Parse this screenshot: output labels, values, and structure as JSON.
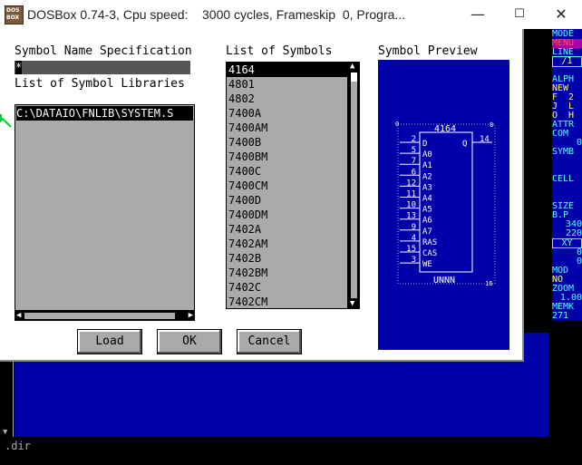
{
  "window": {
    "icon_text": [
      "DOS",
      "BOX"
    ],
    "title": "DOSBox 0.74-3, Cpu speed:    3000 cycles, Frameskip  0, Progra...",
    "minimize": "—",
    "maximize": "☐",
    "close": "✕"
  },
  "dialog": {
    "symbol_name_label": "Symbol Name Specification",
    "symbol_name_value": "*",
    "libraries_label": "List of Symbol Libraries",
    "libraries": [
      "C:\\DATAIO\\FNLIB\\SYSTEM.S"
    ],
    "symbols_label": "List of Symbols",
    "symbols": [
      "4164",
      "4801",
      "4802",
      "7400A",
      "7400AM",
      "7400B",
      "7400BM",
      "7400C",
      "7400CM",
      "7400D",
      "7400DM",
      "7402A",
      "7402AM",
      "7402B",
      "7402BM",
      "7402C",
      "7402CM"
    ],
    "selected_symbol": "4164",
    "preview_label": "Symbol Preview",
    "buttons": {
      "load": "Load",
      "ok": "OK",
      "cancel": "Cancel"
    }
  },
  "preview": {
    "part_name": "4164",
    "ref": "UNNN",
    "corner_left": "0",
    "corner_right": "8",
    "bottom_right": "16",
    "left_pins": [
      {
        "num": "2",
        "name": "D"
      },
      {
        "num": "5",
        "name": "A0"
      },
      {
        "num": "7",
        "name": "A1"
      },
      {
        "num": "6",
        "name": "A2"
      },
      {
        "num": "12",
        "name": "A3"
      },
      {
        "num": "11",
        "name": "A4"
      },
      {
        "num": "10",
        "name": "A5"
      },
      {
        "num": "13",
        "name": "A6"
      },
      {
        "num": "9",
        "name": "A7"
      },
      {
        "num": "4",
        "name": "RAS"
      },
      {
        "num": "15",
        "name": "CAS"
      },
      {
        "num": "3",
        "name": "WE"
      }
    ],
    "right_pins": [
      {
        "num": "14",
        "name": "Q"
      }
    ]
  },
  "sidepanel": {
    "items": [
      "MODE",
      "MENU",
      "LINE",
      "/1",
      "ALPH",
      "NEW",
      "F  2",
      "J  L",
      "O  H",
      "ATTR",
      "COM",
      "0",
      "SYMB",
      "CELL",
      "SIZE",
      "B.P",
      "340",
      "220",
      "XY",
      "0",
      "0",
      "MOD",
      "NO",
      "ZOOM",
      "1.00",
      "MEMK",
      "271"
    ]
  },
  "console": {
    "command": ".dir"
  },
  "colors": {
    "dos_blue": "#0000aa",
    "cyan": "#55ffff",
    "gray": "#aaaaaa",
    "white": "#ffffff"
  }
}
